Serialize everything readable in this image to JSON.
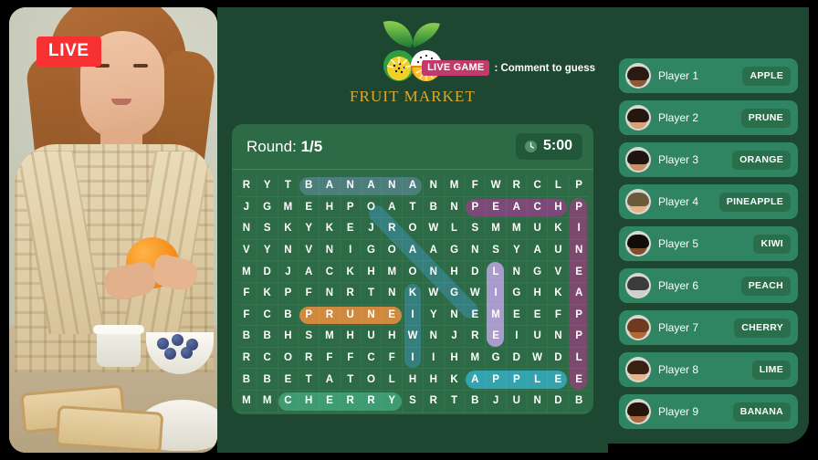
{
  "colors": {
    "page_bg": "#000000",
    "panel_green": "#1d4731",
    "card_green": "#2d6b46",
    "live_red": "#f73131",
    "live_game_pink": "#c13a6b",
    "logo_gold": "#e0a92b",
    "chip_green": "#2a6e4c",
    "player_row_green": "#2f8461",
    "hl_banana": "#4c7f7c",
    "hl_peach": "#7c4a79",
    "hl_pineapple": "#7c4a6e",
    "hl_prune": "#d08a3f",
    "hl_lime": "#a99ccc",
    "hl_kiwi": "#35807e",
    "hl_orange": "#35807e",
    "hl_apple": "#34a3b0",
    "hl_cherry": "#3f9b72"
  },
  "video": {
    "live_badge": "LIVE"
  },
  "brand": {
    "name": "FRUIT MARKET",
    "logo_icon": "fruit-leaves-logo"
  },
  "header": {
    "live_game_badge": "LIVE GAME",
    "live_game_note": ": Comment to guess"
  },
  "game": {
    "round_prefix": "Round:",
    "round_value": "1/5",
    "timer_icon": "clock-icon",
    "timer_value": "5:00"
  },
  "chart_data": {
    "type": "table",
    "title": "Fruit word search grid",
    "rows": 11,
    "cols": 17,
    "grid": [
      [
        "R",
        "Y",
        "T",
        "B",
        "A",
        "N",
        "A",
        "N",
        "A",
        "N",
        "M",
        "F",
        "W",
        "R",
        "C",
        "L",
        "P"
      ],
      [
        "J",
        "G",
        "M",
        "E",
        "H",
        "P",
        "O",
        "A",
        "T",
        "B",
        "N",
        "P",
        "E",
        "A",
        "C",
        "H",
        "P"
      ],
      [
        "N",
        "S",
        "K",
        "Y",
        "K",
        "E",
        "J",
        "R",
        "O",
        "W",
        "L",
        "S",
        "M",
        "M",
        "U",
        "K",
        "I"
      ],
      [
        "V",
        "Y",
        "N",
        "V",
        "N",
        "I",
        "G",
        "O",
        "A",
        "A",
        "G",
        "N",
        "S",
        "Y",
        "A",
        "U",
        "N"
      ],
      [
        "M",
        "D",
        "J",
        "A",
        "C",
        "K",
        "H",
        "M",
        "O",
        "N",
        "H",
        "D",
        "L",
        "N",
        "G",
        "V",
        "E"
      ],
      [
        "F",
        "K",
        "P",
        "F",
        "N",
        "R",
        "T",
        "N",
        "K",
        "W",
        "G",
        "W",
        "I",
        "G",
        "H",
        "K",
        "A"
      ],
      [
        "F",
        "C",
        "B",
        "P",
        "R",
        "U",
        "N",
        "E",
        "I",
        "Y",
        "N",
        "E",
        "M",
        "E",
        "E",
        "F",
        "P"
      ],
      [
        "B",
        "B",
        "H",
        "S",
        "M",
        "H",
        "U",
        "H",
        "W",
        "N",
        "J",
        "R",
        "E",
        "I",
        "U",
        "N",
        "P"
      ],
      [
        "R",
        "C",
        "O",
        "R",
        "F",
        "F",
        "C",
        "F",
        "I",
        "I",
        "H",
        "M",
        "G",
        "D",
        "W",
        "D",
        "L"
      ],
      [
        "B",
        "B",
        "E",
        "T",
        "A",
        "T",
        "O",
        "L",
        "H",
        "H",
        "K",
        "A",
        "P",
        "P",
        "L",
        "E",
        "E"
      ],
      [
        "M",
        "M",
        "C",
        "H",
        "E",
        "R",
        "R",
        "Y",
        "S",
        "R",
        "T",
        "B",
        "J",
        "U",
        "N",
        "D",
        "B"
      ]
    ],
    "found_words": [
      {
        "word": "BANANA",
        "orientation": "horizontal",
        "row": 0,
        "col_start": 3,
        "col_end": 8,
        "color": "#4c7f7c"
      },
      {
        "word": "PEACH",
        "orientation": "horizontal",
        "row": 1,
        "col_start": 11,
        "col_end": 15,
        "color": "#7c4a79"
      },
      {
        "word": "PINEAPPLE",
        "orientation": "vertical",
        "col": 16,
        "row_start": 1,
        "row_end": 9,
        "color": "#7c4a6e"
      },
      {
        "word": "ORANGE",
        "orientation": "diagonal",
        "row_start": 1,
        "col_start": 6,
        "row_end": 6,
        "col_end": 11,
        "color": "#35807e"
      },
      {
        "word": "LIME",
        "orientation": "vertical",
        "col": 12,
        "row_start": 4,
        "row_end": 7,
        "color": "#a99ccc"
      },
      {
        "word": "KIWI",
        "orientation": "vertical",
        "col": 8,
        "row_start": 5,
        "row_end": 8,
        "color": "#35807e"
      },
      {
        "word": "PRUNE",
        "orientation": "horizontal",
        "row": 6,
        "col_start": 3,
        "col_end": 7,
        "color": "#d08a3f"
      },
      {
        "word": "APPLE",
        "orientation": "horizontal",
        "row": 9,
        "col_start": 11,
        "col_end": 15,
        "color": "#34a3b0"
      },
      {
        "word": "CHERRY",
        "orientation": "horizontal",
        "row": 10,
        "col_start": 2,
        "col_end": 7,
        "color": "#3f9b72"
      }
    ]
  },
  "players": [
    {
      "name": "Player 1",
      "guess": "APPLE",
      "hair": "#2a1a12",
      "skin": "#8d5a3b"
    },
    {
      "name": "Player 2",
      "guess": "PRUNE",
      "hair": "#251610",
      "skin": "#d9a178"
    },
    {
      "name": "Player 3",
      "guess": "ORANGE",
      "hair": "#1e1410",
      "skin": "#c79067"
    },
    {
      "name": "Player 4",
      "guess": "PINEAPPLE",
      "hair": "#6b5a3a",
      "skin": "#e0b48c"
    },
    {
      "name": "Player 5",
      "guess": "KIWI",
      "hair": "#120c09",
      "skin": "#7d4e30"
    },
    {
      "name": "Player 6",
      "guess": "PEACH",
      "hair": "#3c3c3c",
      "skin": "#cfcfcf"
    },
    {
      "name": "Player 7",
      "guess": "CHERRY",
      "hair": "#6f3a1d",
      "skin": "#b06a3a"
    },
    {
      "name": "Player 8",
      "guess": "LIME",
      "hair": "#3a2212",
      "skin": "#e3b48d"
    },
    {
      "name": "Player 9",
      "guess": "BANANA",
      "hair": "#241409",
      "skin": "#a86a42"
    }
  ]
}
